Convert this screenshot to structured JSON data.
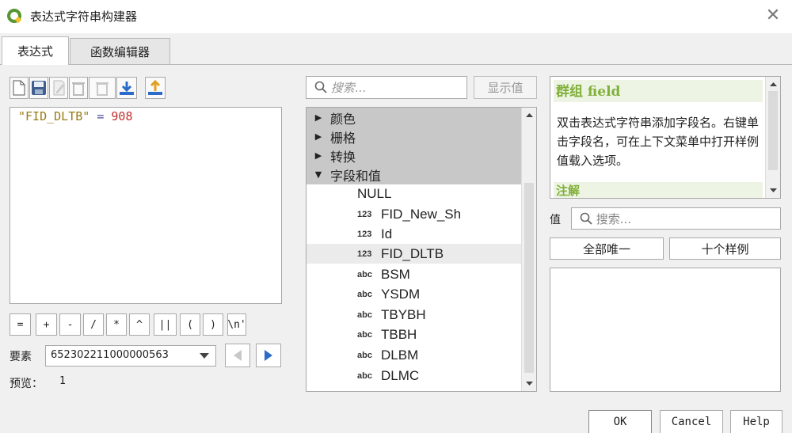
{
  "window": {
    "title": "表达式字符串构建器",
    "close_icon": "close-icon"
  },
  "tabs": [
    {
      "label": "表达式"
    },
    {
      "label": "函数编辑器"
    }
  ],
  "toolbar": {
    "icons": [
      "new-file-icon",
      "save-icon",
      "edit-icon",
      "delete-icon",
      "import-icon",
      "export-icon"
    ]
  },
  "editor": {
    "field": "\"FID_DLTB\"",
    "op": "=",
    "num": "908"
  },
  "operators": [
    "=",
    "+",
    "-",
    "/",
    "*",
    "^",
    "||",
    "(",
    ")",
    "\\n'"
  ],
  "feature": {
    "label": "要素",
    "value": "652302211000000563"
  },
  "preview": {
    "label": "预览：",
    "value": "1"
  },
  "search": {
    "placeholder": "搜索...",
    "show_values_label": "显示值"
  },
  "tree": {
    "categories": [
      "颜色",
      "栅格",
      "转换",
      "字段和值"
    ],
    "fields": [
      {
        "type": "",
        "name": "NULL"
      },
      {
        "type": "123",
        "name": "FID_New_Sh"
      },
      {
        "type": "123",
        "name": "Id"
      },
      {
        "type": "123",
        "name": "FID_DLTB"
      },
      {
        "type": "abc",
        "name": "BSM"
      },
      {
        "type": "abc",
        "name": "YSDM"
      },
      {
        "type": "abc",
        "name": "TBYBH"
      },
      {
        "type": "abc",
        "name": "TBBH"
      },
      {
        "type": "abc",
        "name": "DLBM"
      },
      {
        "type": "abc",
        "name": "DLMC"
      }
    ]
  },
  "help": {
    "title": "群组 field",
    "body": "双击表达式字符串添加字段名。右键单击字段名，可在上下文菜单中打开样例值载入选项。",
    "section": "注解"
  },
  "values": {
    "label": "值",
    "search_placeholder": "搜索...",
    "all_unique": "全部唯一",
    "ten_samples": "十个样例"
  },
  "buttons": {
    "ok": "OK",
    "cancel": "Cancel",
    "help": "Help"
  }
}
